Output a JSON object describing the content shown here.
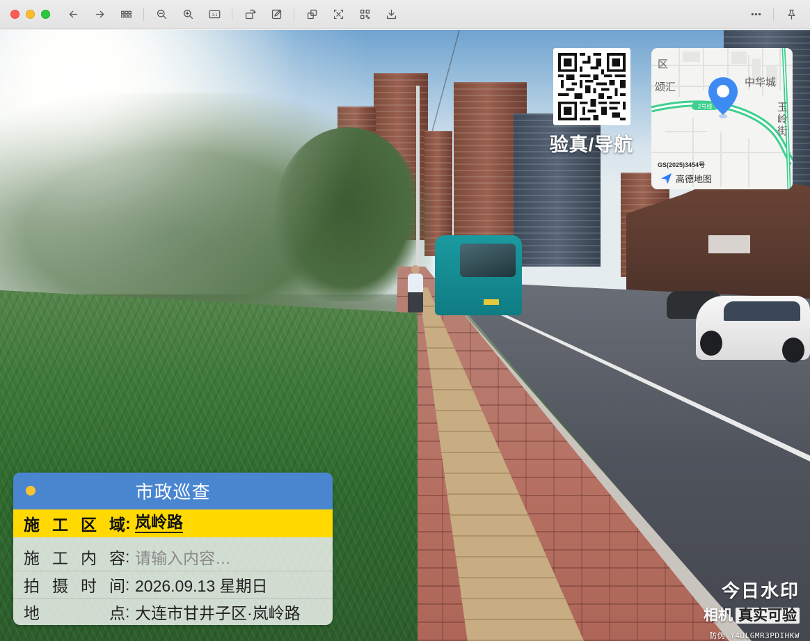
{
  "toolbar": {
    "buttons": [
      "back",
      "forward",
      "thumbnails",
      "zoom-out",
      "zoom-in",
      "actual-size",
      "rotate",
      "markup",
      "adjust",
      "crop",
      "qr-scan",
      "export",
      "more",
      "pin"
    ],
    "actual_size_label": "1:1"
  },
  "qr": {
    "label": "验真/导航"
  },
  "map": {
    "labels": [
      "区",
      "颂汇",
      "中华城",
      "玉",
      "岭",
      "街"
    ],
    "road_label": "2号线",
    "approval": "GS(2025)3454号",
    "brand": "高德地图",
    "colors": {
      "road": "#3ecf8e",
      "pin": "#3d8bf2"
    }
  },
  "card": {
    "title": "市政巡查",
    "rows": [
      {
        "key": "施工区域",
        "value": "岚岭路"
      },
      {
        "key": "施工内容",
        "value": "请输入内容…"
      },
      {
        "key": "拍摄时间",
        "value": "2026.09.13 星期日"
      },
      {
        "key": "地点",
        "value": "大连市甘井子区·岚岭路"
      }
    ],
    "colors": {
      "header": "#4a86cf",
      "highlight": "#ffd900",
      "dot": "#f7c331"
    }
  },
  "watermark": {
    "line1": "今日水印",
    "line2_a": "相机",
    "line2_b": "真实可验",
    "line3": "防伪 Y4DLGMR3PDIHKW"
  }
}
